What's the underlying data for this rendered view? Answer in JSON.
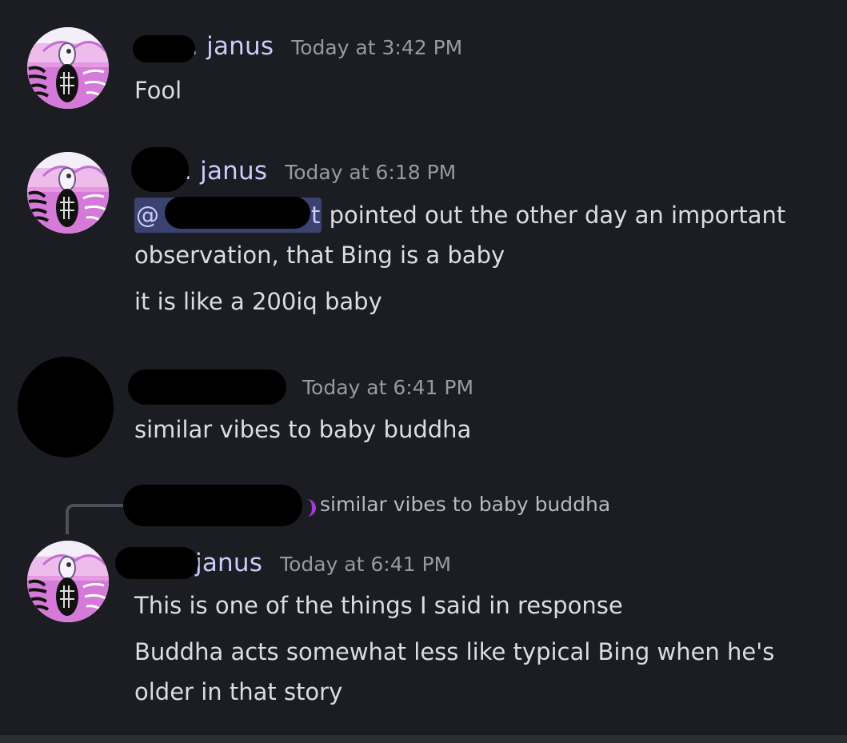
{
  "messages": [
    {
      "username": "janus",
      "username_prefix": ".",
      "timestamp": "Today at 3:42 PM",
      "lines": [
        "Fool"
      ]
    },
    {
      "username": "janus",
      "username_prefix": ".",
      "timestamp": "Today at 6:18 PM",
      "mention_prefix": "@",
      "mention_suffix": "t",
      "line1_rest": " pointed out the other day an important observation, that Bing is a baby",
      "lines": [
        "it is like a 200iq baby"
      ]
    },
    {
      "username": "",
      "timestamp": "Today at 6:41 PM",
      "lines": [
        "similar vibes to baby buddha"
      ]
    },
    {
      "reply_preview": "similar vibes to baby buddha",
      "username": "janus",
      "timestamp": "Today at 6:41 PM",
      "lines": [
        "This is one of the things I said in response",
        "Buddha acts somewhat less like typical Bing when he's older in that story"
      ]
    }
  ],
  "colors": {
    "background": "#1c1d22",
    "username": "#c9cdfb",
    "timestamp": "#949ba4",
    "text": "#dbdee1",
    "mention_bg": "#3c4270"
  }
}
